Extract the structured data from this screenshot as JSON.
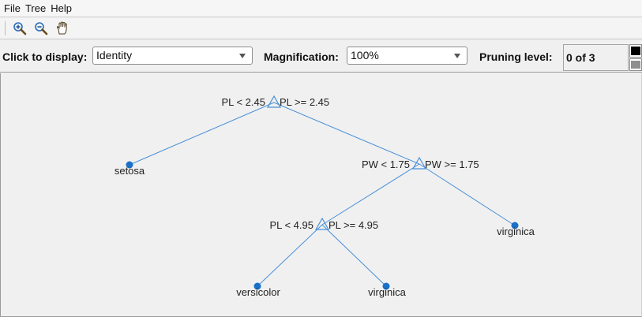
{
  "menu": [
    "File",
    "Tree",
    "Help"
  ],
  "toolbar": {
    "buttons": [
      "zoom-in-icon",
      "zoom-out-icon",
      "pan-hand-icon"
    ]
  },
  "controls": {
    "display_label": "Click to display:",
    "display_value": "Identity",
    "magnification_label": "Magnification:",
    "magnification_value": "100%",
    "pruning_label": "Pruning level:",
    "pruning_value": "0 of 3"
  },
  "tree": {
    "line_color": "#4a90d9",
    "node_color": "#1a6fc7",
    "splits": [
      {
        "left": "PL < 2.45",
        "right": "PL >= 2.45"
      },
      {
        "left": "PW < 1.75",
        "right": "PW >= 1.75"
      },
      {
        "left": "PL < 4.95",
        "right": "PL >= 4.95"
      }
    ],
    "leaves": [
      "setosa",
      "virginica",
      "versicolor",
      "virginica"
    ]
  }
}
